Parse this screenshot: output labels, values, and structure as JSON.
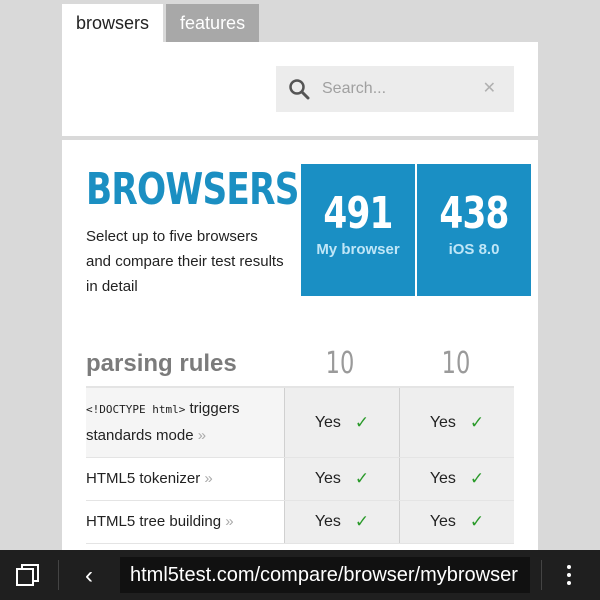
{
  "tabs": [
    {
      "label": "browsers",
      "active": true
    },
    {
      "label": "features",
      "active": false
    }
  ],
  "search": {
    "placeholder": "Search...",
    "value": ""
  },
  "main": {
    "title": "BROWSERS",
    "description": "Select up to five browsers and compare their test results in detail",
    "scores": [
      {
        "value": "491",
        "label": "My browser"
      },
      {
        "value": "438",
        "label": "iOS 8.0"
      }
    ]
  },
  "section": {
    "title": "parsing rules",
    "column_scores": [
      "10",
      "10"
    ],
    "rows": [
      {
        "code": "<!DOCTYPE html>",
        "label": " triggers standards mode",
        "chevron": "»",
        "values": [
          "Yes",
          "Yes"
        ]
      },
      {
        "code": "",
        "label": "HTML5 tokenizer",
        "chevron": "»",
        "values": [
          "Yes",
          "Yes"
        ]
      },
      {
        "code": "",
        "label": "HTML5 tree building",
        "chevron": "»",
        "values": [
          "Yes",
          "Yes"
        ]
      }
    ]
  },
  "browser_bar": {
    "url": "html5test.com/compare/browser/mybrowser"
  },
  "colors": {
    "accent": "#1a8fc4",
    "check": "#2a9a2a",
    "bar": "#1f1f1f"
  }
}
